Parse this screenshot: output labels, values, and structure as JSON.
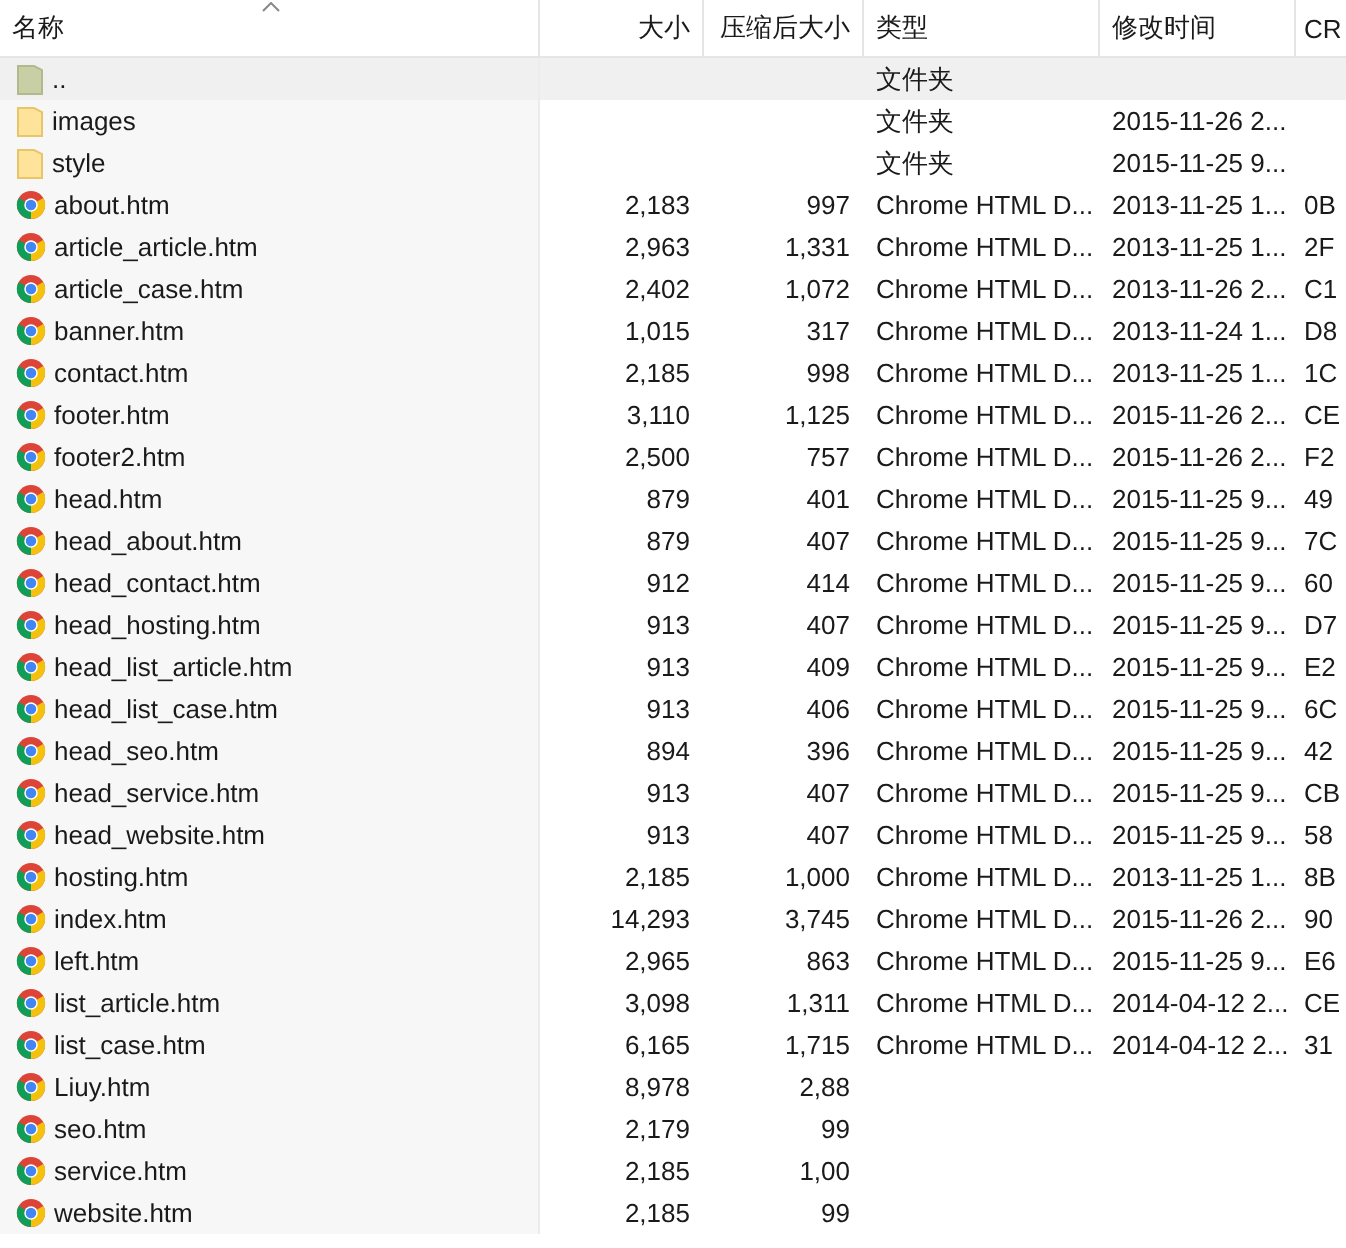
{
  "columns": [
    {
      "label": "名称",
      "sorted": true
    },
    {
      "label": "大小",
      "sorted": false
    },
    {
      "label": "压缩后大小",
      "sorted": false
    },
    {
      "label": "类型",
      "sorted": false
    },
    {
      "label": "修改时间",
      "sorted": false
    },
    {
      "label": "CR",
      "sorted": false
    }
  ],
  "rows": [
    {
      "kind": "parent",
      "selected": true,
      "name": "..",
      "type": "文件夹"
    },
    {
      "kind": "folder",
      "selected": false,
      "name": "images",
      "type": "文件夹",
      "modified": "2015-11-26 2..."
    },
    {
      "kind": "folder",
      "selected": false,
      "name": "style",
      "type": "文件夹",
      "modified": "2015-11-25 9..."
    },
    {
      "kind": "file",
      "selected": false,
      "name": "about.htm",
      "size": "2,183",
      "packed": "997",
      "type": "Chrome HTML D...",
      "modified": "2013-11-25 1...",
      "crc": "0B"
    },
    {
      "kind": "file",
      "selected": false,
      "name": "article_article.htm",
      "size": "2,963",
      "packed": "1,331",
      "type": "Chrome HTML D...",
      "modified": "2013-11-25 1...",
      "crc": "2F"
    },
    {
      "kind": "file",
      "selected": false,
      "name": "article_case.htm",
      "size": "2,402",
      "packed": "1,072",
      "type": "Chrome HTML D...",
      "modified": "2013-11-26 2...",
      "crc": "C1"
    },
    {
      "kind": "file",
      "selected": false,
      "name": "banner.htm",
      "size": "1,015",
      "packed": "317",
      "type": "Chrome HTML D...",
      "modified": "2013-11-24 1...",
      "crc": "D8"
    },
    {
      "kind": "file",
      "selected": false,
      "name": "contact.htm",
      "size": "2,185",
      "packed": "998",
      "type": "Chrome HTML D...",
      "modified": "2013-11-25 1...",
      "crc": "1C"
    },
    {
      "kind": "file",
      "selected": false,
      "name": "footer.htm",
      "size": "3,110",
      "packed": "1,125",
      "type": "Chrome HTML D...",
      "modified": "2015-11-26 2...",
      "crc": "CE"
    },
    {
      "kind": "file",
      "selected": false,
      "name": "footer2.htm",
      "size": "2,500",
      "packed": "757",
      "type": "Chrome HTML D...",
      "modified": "2015-11-26 2...",
      "crc": "F2"
    },
    {
      "kind": "file",
      "selected": false,
      "name": "head.htm",
      "size": "879",
      "packed": "401",
      "type": "Chrome HTML D...",
      "modified": "2015-11-25 9...",
      "crc": "49"
    },
    {
      "kind": "file",
      "selected": false,
      "name": "head_about.htm",
      "size": "879",
      "packed": "407",
      "type": "Chrome HTML D...",
      "modified": "2015-11-25 9...",
      "crc": "7C"
    },
    {
      "kind": "file",
      "selected": false,
      "name": "head_contact.htm",
      "size": "912",
      "packed": "414",
      "type": "Chrome HTML D...",
      "modified": "2015-11-25 9...",
      "crc": "60"
    },
    {
      "kind": "file",
      "selected": false,
      "name": "head_hosting.htm",
      "size": "913",
      "packed": "407",
      "type": "Chrome HTML D...",
      "modified": "2015-11-25 9...",
      "crc": "D7"
    },
    {
      "kind": "file",
      "selected": false,
      "name": "head_list_article.htm",
      "size": "913",
      "packed": "409",
      "type": "Chrome HTML D...",
      "modified": "2015-11-25 9...",
      "crc": "E2"
    },
    {
      "kind": "file",
      "selected": false,
      "name": "head_list_case.htm",
      "size": "913",
      "packed": "406",
      "type": "Chrome HTML D...",
      "modified": "2015-11-25 9...",
      "crc": "6C"
    },
    {
      "kind": "file",
      "selected": false,
      "name": "head_seo.htm",
      "size": "894",
      "packed": "396",
      "type": "Chrome HTML D...",
      "modified": "2015-11-25 9...",
      "crc": "42"
    },
    {
      "kind": "file",
      "selected": false,
      "name": "head_service.htm",
      "size": "913",
      "packed": "407",
      "type": "Chrome HTML D...",
      "modified": "2015-11-25 9...",
      "crc": "CB"
    },
    {
      "kind": "file",
      "selected": false,
      "name": "head_website.htm",
      "size": "913",
      "packed": "407",
      "type": "Chrome HTML D...",
      "modified": "2015-11-25 9...",
      "crc": "58"
    },
    {
      "kind": "file",
      "selected": false,
      "name": "hosting.htm",
      "size": "2,185",
      "packed": "1,000",
      "type": "Chrome HTML D...",
      "modified": "2013-11-25 1...",
      "crc": "8B"
    },
    {
      "kind": "file",
      "selected": false,
      "name": "index.htm",
      "size": "14,293",
      "packed": "3,745",
      "type": "Chrome HTML D...",
      "modified": "2015-11-26 2...",
      "crc": "90"
    },
    {
      "kind": "file",
      "selected": false,
      "name": "left.htm",
      "size": "2,965",
      "packed": "863",
      "type": "Chrome HTML D...",
      "modified": "2015-11-25 9...",
      "crc": "E6"
    },
    {
      "kind": "file",
      "selected": false,
      "name": "list_article.htm",
      "size": "3,098",
      "packed": "1,311",
      "type": "Chrome HTML D...",
      "modified": "2014-04-12 2...",
      "crc": "CE"
    },
    {
      "kind": "file",
      "selected": false,
      "name": "list_case.htm",
      "size": "6,165",
      "packed": "1,715",
      "type": "Chrome HTML D...",
      "modified": "2014-04-12 2...",
      "crc": "31"
    },
    {
      "kind": "file",
      "selected": false,
      "name": "Liuy.htm",
      "size": "8,978",
      "packed": "2,88"
    },
    {
      "kind": "file",
      "selected": false,
      "name": "seo.htm",
      "size": "2,179",
      "packed": "99"
    },
    {
      "kind": "file",
      "selected": false,
      "name": "service.htm",
      "size": "2,185",
      "packed": "1,00"
    },
    {
      "kind": "file",
      "selected": false,
      "name": "website.htm",
      "size": "2,185",
      "packed": "99"
    }
  ]
}
